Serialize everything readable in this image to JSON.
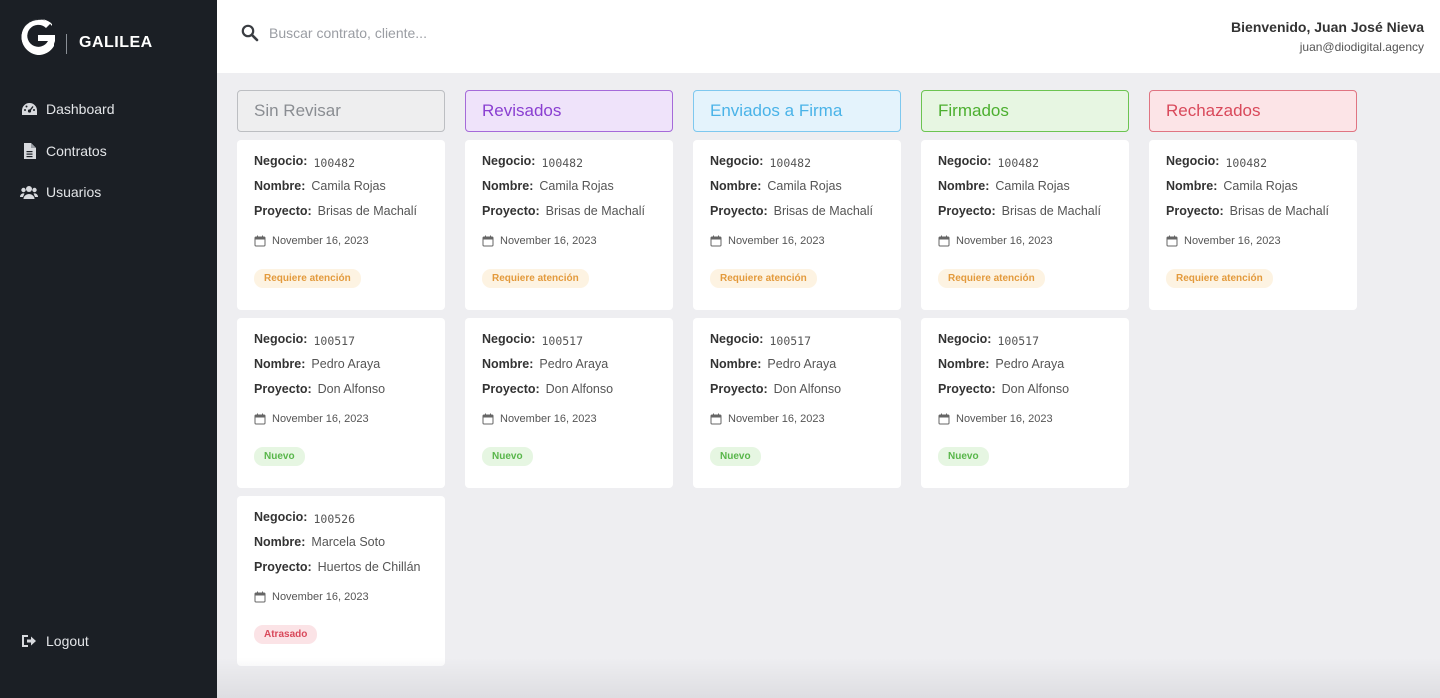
{
  "app": {
    "name": "GALILEA"
  },
  "sidebar": {
    "items": [
      {
        "label": "Dashboard",
        "icon": "dashboard-icon"
      },
      {
        "label": "Contratos",
        "icon": "document-icon"
      },
      {
        "label": "Usuarios",
        "icon": "users-icon"
      }
    ],
    "logout_label": "Logout"
  },
  "header": {
    "search_placeholder": "Buscar contrato, cliente...",
    "welcome": "Bienvenido, Juan José Nieva",
    "email": "juan@diodigital.agency"
  },
  "labels": {
    "negocio": "Negocio:",
    "nombre": "Nombre:",
    "proyecto": "Proyecto:"
  },
  "colors": {
    "sin_revisar": "#8a8d92",
    "revisados": "#8a3fd1",
    "enviados": "#4ab3e8",
    "firmados": "#4caf2f",
    "rechazados": "#d9495b"
  },
  "columns": [
    {
      "title": "Sin Revisar",
      "cards": [
        {
          "negocio": "100482",
          "nombre": "Camila Rojas",
          "proyecto": "Brisas de Machalí",
          "fecha": "November 16, 2023",
          "status": "Requiere atención"
        },
        {
          "negocio": "100517",
          "nombre": "Pedro Araya",
          "proyecto": "Don Alfonso",
          "fecha": "November 16, 2023",
          "status": "Nuevo"
        },
        {
          "negocio": "100526",
          "nombre": "Marcela Soto",
          "proyecto": "Huertos de Chillán",
          "fecha": "November 16, 2023",
          "status": "Atrasado"
        }
      ]
    },
    {
      "title": "Revisados",
      "cards": [
        {
          "negocio": "100482",
          "nombre": "Camila Rojas",
          "proyecto": "Brisas de Machalí",
          "fecha": "November 16, 2023",
          "status": "Requiere atención"
        },
        {
          "negocio": "100517",
          "nombre": "Pedro Araya",
          "proyecto": "Don Alfonso",
          "fecha": "November 16, 2023",
          "status": "Nuevo"
        }
      ]
    },
    {
      "title": "Enviados a Firma",
      "cards": [
        {
          "negocio": "100482",
          "nombre": "Camila Rojas",
          "proyecto": "Brisas de Machalí",
          "fecha": "November 16, 2023",
          "status": "Requiere atención"
        },
        {
          "negocio": "100517",
          "nombre": "Pedro Araya",
          "proyecto": "Don Alfonso",
          "fecha": "November 16, 2023",
          "status": "Nuevo"
        }
      ]
    },
    {
      "title": "Firmados",
      "cards": [
        {
          "negocio": "100482",
          "nombre": "Camila Rojas",
          "proyecto": "Brisas de Machalí",
          "fecha": "November 16, 2023",
          "status": "Requiere atención"
        },
        {
          "negocio": "100517",
          "nombre": "Pedro Araya",
          "proyecto": "Don Alfonso",
          "fecha": "November 16, 2023",
          "status": "Nuevo"
        }
      ]
    },
    {
      "title": "Rechazados",
      "cards": [
        {
          "negocio": "100482",
          "nombre": "Camila Rojas",
          "proyecto": "Brisas de Machalí",
          "fecha": "November 16, 2023",
          "status": "Requiere atención"
        }
      ]
    }
  ]
}
